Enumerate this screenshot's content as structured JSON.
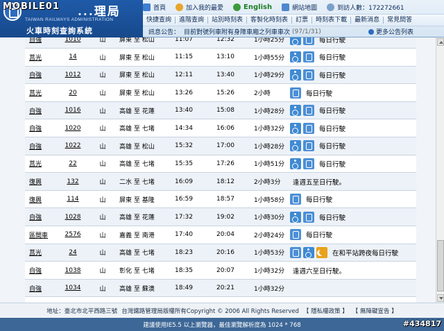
{
  "header": {
    "logo_title": "...理局",
    "logo_en": "TAIWAN RAILWAYS ADMINISTRATION",
    "logo_zh": "火車時刻查詢系統",
    "watermark": "MOBILE01",
    "top_links": [
      {
        "label": "首頁",
        "icon": "home-icon"
      },
      {
        "label": "加入我的最愛",
        "icon": "favorite-icon"
      },
      {
        "label": "English",
        "icon": "english-icon"
      },
      {
        "label": "網站地圖",
        "icon": "sitemap-icon"
      },
      {
        "label": "到訪人數：172272661",
        "icon": "visitor-icon"
      }
    ],
    "nav": [
      "快捷查詢",
      "進階查詢",
      "站別時刻表",
      "客製化時刻表",
      "訂票",
      "時刻表下載",
      "最新消息",
      "常見問答"
    ],
    "notice_label": "訊息公告：",
    "notice_text": "目前對號列車附有身障車廂之列車車次",
    "notice_date": "(97/1/31)",
    "notice_more": "更多公告列表"
  },
  "table": {
    "rows": [
      {
        "type": "自強",
        "no": "1010",
        "line": "山",
        "route": "屏東  至  松山",
        "dep": "11:07",
        "arr": "12:32",
        "dur": "1小時25分",
        "icons": [
          "wheelchair-icon",
          "seat-icon"
        ],
        "note": "每日行駛"
      },
      {
        "type": "莒光",
        "no": "14",
        "line": "山",
        "route": "屏東  至  松山",
        "dep": "11:15",
        "arr": "13:10",
        "dur": "1小時55分",
        "icons": [
          "wheelchair-icon",
          "seat-icon"
        ],
        "note": "每日行駛"
      },
      {
        "type": "自強",
        "no": "1012",
        "line": "山",
        "route": "屏東  至  松山",
        "dep": "12:11",
        "arr": "13:40",
        "dur": "1小時29分",
        "icons": [
          "wheelchair-icon",
          "seat-icon"
        ],
        "note": "每日行駛"
      },
      {
        "type": "莒光",
        "no": "20",
        "line": "山",
        "route": "屏東  至  松山",
        "dep": "13:26",
        "arr": "15:26",
        "dur": "2小時",
        "icons": [
          "seat-icon"
        ],
        "note": "每日行駛"
      },
      {
        "type": "自強",
        "no": "1016",
        "line": "山",
        "route": "高雄  至  花蓮",
        "dep": "13:40",
        "arr": "15:08",
        "dur": "1小時28分",
        "icons": [
          "wheelchair-icon",
          "seat-icon"
        ],
        "note": "每日行駛"
      },
      {
        "type": "自強",
        "no": "1020",
        "line": "山",
        "route": "高雄  至  七堵",
        "dep": "14:34",
        "arr": "16:06",
        "dur": "1小時32分",
        "icons": [
          "wheelchair-icon",
          "seat-icon"
        ],
        "note": "每日行駛"
      },
      {
        "type": "自強",
        "no": "1022",
        "line": "山",
        "route": "高雄  至  松山",
        "dep": "15:32",
        "arr": "17:00",
        "dur": "1小時28分",
        "icons": [
          "wheelchair-icon",
          "seat-icon"
        ],
        "note": "每日行駛"
      },
      {
        "type": "莒光",
        "no": "22",
        "line": "山",
        "route": "高雄  至  七堵",
        "dep": "15:35",
        "arr": "17:26",
        "dur": "1小時51分",
        "icons": [
          "wheelchair-icon",
          "seat-icon"
        ],
        "note": "每日行駛"
      },
      {
        "type": "復興",
        "no": "132",
        "line": "山",
        "route": "二水  至  七堵",
        "dep": "16:09",
        "arr": "18:12",
        "dur": "2小時3分",
        "icons": [],
        "note": "逢週五至日行駛。"
      },
      {
        "type": "復興",
        "no": "114",
        "line": "山",
        "route": "屏東  至  基隆",
        "dep": "16:59",
        "arr": "18:57",
        "dur": "1小時58分",
        "icons": [
          "seat-icon"
        ],
        "note": "每日行駛"
      },
      {
        "type": "自強",
        "no": "1028",
        "line": "山",
        "route": "高雄  至  花蓮",
        "dep": "17:32",
        "arr": "19:02",
        "dur": "1小時30分",
        "icons": [
          "wheelchair-icon",
          "seat-icon"
        ],
        "note": "每日行駛"
      },
      {
        "type": "區間車",
        "no": "2576",
        "line": "山",
        "route": "嘉義  至  南港",
        "dep": "17:40",
        "arr": "20:04",
        "dur": "2小時24分",
        "icons": [
          "seat-icon"
        ],
        "note": "每日行駛"
      },
      {
        "type": "莒光",
        "no": "24",
        "line": "山",
        "route": "高雄  至  七堵",
        "dep": "18:23",
        "arr": "20:16",
        "dur": "1小時53分",
        "icons": [
          "seat-icon",
          "wheelchair-icon",
          "night-icon"
        ],
        "note": "在和平站跨夜每日行駛"
      },
      {
        "type": "自強",
        "no": "1038",
        "line": "山",
        "route": "彰化  至  七堵",
        "dep": "18:35",
        "arr": "20:07",
        "dur": "1小時32分",
        "icons": [],
        "note": "逢週六至日行駛。"
      },
      {
        "type": "自強",
        "no": "1034",
        "line": "山",
        "route": "高雄  至  蘇澳",
        "dep": "18:49",
        "arr": "20:21",
        "dur": "1小時32分",
        "icons": [],
        "note": ""
      }
    ]
  },
  "footer": {
    "address": "地址：臺北市北平西路三號",
    "copyright": "台灣鐵路管理局版權所有Copyright © 2006 All Rights Reserved",
    "privacy": "【 隱私權政策 】",
    "accessibility": "【 無障礙宣告 】",
    "bottom_note": "建議使用IE5.5 以上瀏覽器，最佳瀏覽解析度為 1024 * 768",
    "watermark_id": "#434817"
  }
}
